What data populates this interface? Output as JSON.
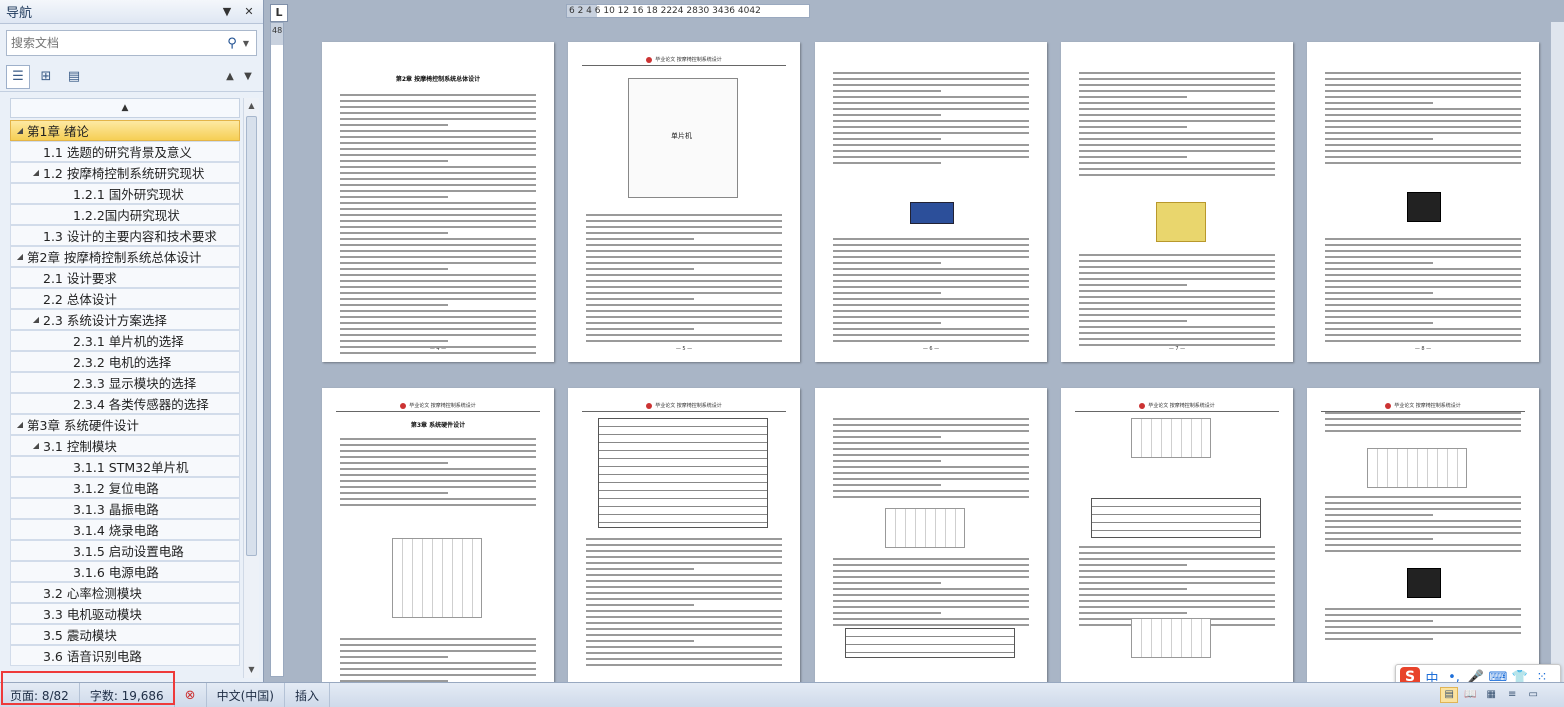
{
  "nav": {
    "title": "导航",
    "search_placeholder": "搜索文档",
    "tree": [
      {
        "label": "第1章  绪论",
        "level": 1,
        "toggle": "◢",
        "active": true
      },
      {
        "label": "1.1  选题的研究背景及意义",
        "level": 2,
        "toggle": ""
      },
      {
        "label": "1.2  按摩椅控制系统研究现状",
        "level": 2,
        "toggle": "◢"
      },
      {
        "label": "1.2.1 国外研究现状",
        "level": 3,
        "toggle": ""
      },
      {
        "label": "1.2.2国内研究现状",
        "level": 3,
        "toggle": ""
      },
      {
        "label": "1.3  设计的主要内容和技术要求",
        "level": 2,
        "toggle": ""
      },
      {
        "label": "第2章  按摩椅控制系统总体设计",
        "level": 1,
        "toggle": "◢"
      },
      {
        "label": "2.1 设计要求",
        "level": 2,
        "toggle": ""
      },
      {
        "label": "2.2 总体设计",
        "level": 2,
        "toggle": ""
      },
      {
        "label": "2.3 系统设计方案选择",
        "level": 2,
        "toggle": "◢"
      },
      {
        "label": "2.3.1 单片机的选择",
        "level": 3,
        "toggle": ""
      },
      {
        "label": "2.3.2 电机的选择",
        "level": 3,
        "toggle": ""
      },
      {
        "label": "2.3.3 显示模块的选择",
        "level": 3,
        "toggle": ""
      },
      {
        "label": "2.3.4 各类传感器的选择",
        "level": 3,
        "toggle": ""
      },
      {
        "label": "第3章  系统硬件设计",
        "level": 1,
        "toggle": "◢"
      },
      {
        "label": "3.1 控制模块",
        "level": 2,
        "toggle": "◢"
      },
      {
        "label": "3.1.1 STM32单片机",
        "level": 3,
        "toggle": ""
      },
      {
        "label": "3.1.2 复位电路",
        "level": 3,
        "toggle": ""
      },
      {
        "label": "3.1.3 晶振电路",
        "level": 3,
        "toggle": ""
      },
      {
        "label": "3.1.4 烧录电路",
        "level": 3,
        "toggle": ""
      },
      {
        "label": "3.1.5 启动设置电路",
        "level": 3,
        "toggle": ""
      },
      {
        "label": "3.1.6 电源电路",
        "level": 3,
        "toggle": ""
      },
      {
        "label": "3.2 心率检测模块",
        "level": 2,
        "toggle": ""
      },
      {
        "label": "3.3 电机驱动模块",
        "level": 2,
        "toggle": ""
      },
      {
        "label": "3.5 震动模块",
        "level": 2,
        "toggle": ""
      },
      {
        "label": "3.6 语音识别电路",
        "level": 2,
        "toggle": ""
      }
    ]
  },
  "ruler": {
    "horizontal": "6  2     4  6  10 12   16 18   2224   2830   3436  4042",
    "vertical": "48"
  },
  "pages": [
    {
      "title": "第2章  按摩椅控制系统总体设计",
      "header": "",
      "num": "— 4 —"
    },
    {
      "title": "",
      "header": "毕业论文  按摩椅控制系统设计",
      "num": "— 5 —",
      "figure_label": "单片机"
    },
    {
      "title": "",
      "header": "",
      "num": "— 6 —"
    },
    {
      "title": "",
      "header": "",
      "num": "— 7 —"
    },
    {
      "title": "",
      "header": "",
      "num": "— 8 —"
    },
    {
      "title": "第3章  系统硬件设计",
      "header": "毕业论文  按摩椅控制系统设计",
      "num": ""
    },
    {
      "title": "",
      "header": "毕业论文  按摩椅控制系统设计",
      "num": ""
    },
    {
      "title": "",
      "header": "",
      "num": ""
    },
    {
      "title": "",
      "header": "毕业论文  按摩椅控制系统设计",
      "num": ""
    },
    {
      "title": "",
      "header": "毕业论文  按摩椅控制系统设计",
      "num": ""
    }
  ],
  "status": {
    "page": "页面: 8/82",
    "words": "字数: 19,686",
    "language": "中文(中国)",
    "mode": "插入"
  },
  "ime": {
    "logo": "S",
    "lang": "中",
    "punct": "•,"
  }
}
